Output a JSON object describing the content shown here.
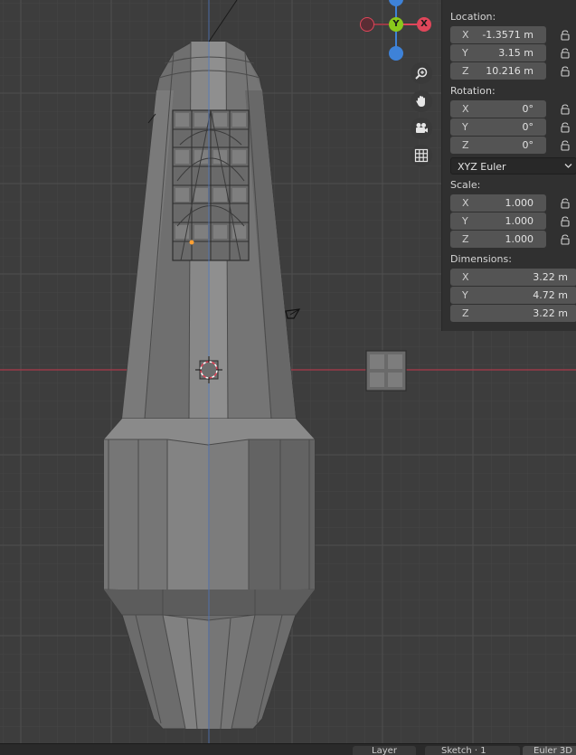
{
  "colors": {
    "background": "#3d3d3d",
    "grid_minor": "#444444",
    "grid_major": "#4c4c4c",
    "x_axis": "#9a3a48",
    "z_axis": "#4d73b8",
    "gizmo_x": "#e0465a",
    "gizmo_y": "#8ac81c",
    "gizmo_z": "#3e82d8",
    "mesh_light": "#8c8c8c",
    "mesh_mid": "#7a7a7a",
    "mesh_dark": "#5f5f5f",
    "panel_bg": "#303030",
    "field_bg": "#545454",
    "selected_vertex": "#ffa033"
  },
  "gizmo": {
    "x_label": "X",
    "y_label": "Y"
  },
  "tools": [
    {
      "name": "zoom",
      "icon": "zoom-icon"
    },
    {
      "name": "pan",
      "icon": "hand-icon"
    },
    {
      "name": "camera",
      "icon": "camera-icon"
    },
    {
      "name": "ortho",
      "icon": "grid-icon"
    }
  ],
  "panel": {
    "location": {
      "label": "Location:",
      "fields": [
        {
          "axis": "X",
          "value": "-1.3571 m"
        },
        {
          "axis": "Y",
          "value": "3.15 m"
        },
        {
          "axis": "Z",
          "value": "10.216 m"
        }
      ]
    },
    "rotation": {
      "label": "Rotation:",
      "fields": [
        {
          "axis": "X",
          "value": "0°"
        },
        {
          "axis": "Y",
          "value": "0°"
        },
        {
          "axis": "Z",
          "value": "0°"
        }
      ]
    },
    "rotation_mode": "XYZ Euler",
    "scale": {
      "label": "Scale:",
      "fields": [
        {
          "axis": "X",
          "value": "1.000"
        },
        {
          "axis": "Y",
          "value": "1.000"
        },
        {
          "axis": "Z",
          "value": "1.000"
        }
      ]
    },
    "dimensions": {
      "label": "Dimensions:",
      "fields": [
        {
          "axis": "X",
          "value": "3.22 m"
        },
        {
          "axis": "Y",
          "value": "4.72 m"
        },
        {
          "axis": "Z",
          "value": "3.22 m"
        }
      ]
    }
  },
  "statusbar": {
    "item1": "Layer",
    "item2": "Sketch · 1",
    "item3": "Euler 3D"
  }
}
